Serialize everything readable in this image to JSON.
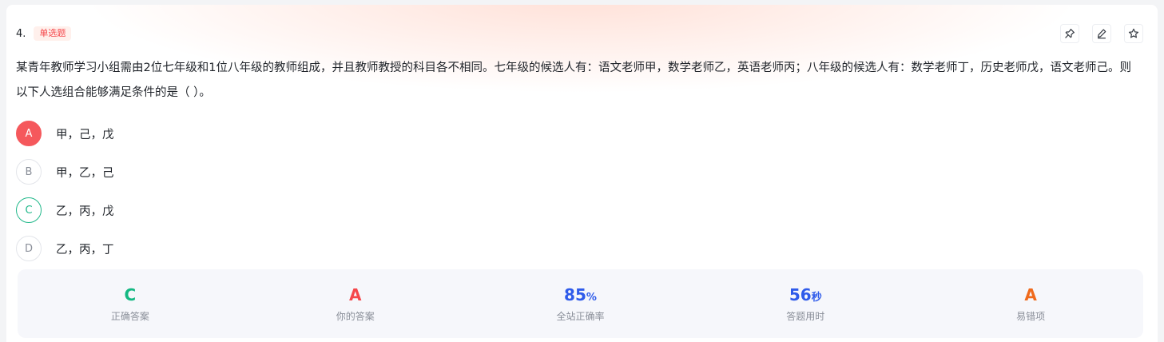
{
  "question": {
    "number": "4.",
    "type_tag": "单选题",
    "stem": "某青年教师学习小组需由2位七年级和1位八年级的教师组成，并且教师教授的科目各不相同。七年级的候选人有：语文老师甲，数学老师乙，英语老师丙；八年级的候选人有：数学老师丁，历史老师戊，语文老师己。则以下人选组合能够满足条件的是（ ）。"
  },
  "toolbar": {
    "icons": [
      "pin-icon",
      "edit-icon",
      "star-icon"
    ]
  },
  "options": [
    {
      "letter": "A",
      "text": "甲，己，戊",
      "state": "selected-wrong"
    },
    {
      "letter": "B",
      "text": "甲，乙，己",
      "state": "normal"
    },
    {
      "letter": "C",
      "text": "乙，丙，戊",
      "state": "correct"
    },
    {
      "letter": "D",
      "text": "乙，丙，丁",
      "state": "normal"
    }
  ],
  "stats": {
    "correct_answer": {
      "value": "C",
      "label": "正确答案"
    },
    "your_answer": {
      "value": "A",
      "label": "你的答案"
    },
    "accuracy": {
      "value": "85",
      "unit": "%",
      "label": "全站正确率"
    },
    "time_used": {
      "value": "56",
      "unit": "秒",
      "label": "答题用时"
    },
    "common_wrong": {
      "value": "A",
      "label": "易错项"
    }
  },
  "colors": {
    "correct": "#14b882",
    "wrong": "#f5474b",
    "blue": "#2f5bea",
    "orange": "#f06a1c"
  }
}
